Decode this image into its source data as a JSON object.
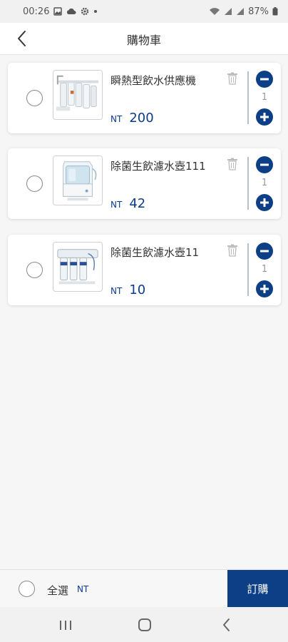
{
  "status_bar": {
    "time": "00:26",
    "left_icons": [
      "gallery-icon",
      "cloud-icon",
      "settings-icon",
      "dot-icon"
    ],
    "battery": "87%",
    "right_icons": [
      "wifi-icon",
      "signal-icon",
      "signal-icon",
      "battery-icon"
    ]
  },
  "header": {
    "title": "購物車",
    "back_icon": "chevron-left-icon"
  },
  "cart": {
    "items": [
      {
        "name": "瞬熱型飲水供應機",
        "currency": "NT",
        "price": "200",
        "quantity": "1"
      },
      {
        "name": "除菌生飲濾水壺111",
        "currency": "NT",
        "price": "42",
        "quantity": "1"
      },
      {
        "name": "除菌生飲濾水壺11",
        "currency": "NT",
        "price": "10",
        "quantity": "1"
      }
    ]
  },
  "footer": {
    "select_all_label": "全選",
    "total_currency": "NT",
    "order_label": "訂購"
  },
  "colors": {
    "accent": "#0d3f86",
    "price": "#0a3c8c",
    "background": "#f6f6f6"
  },
  "nav_bar": {
    "icons": [
      "recent-apps-icon",
      "home-icon",
      "back-icon"
    ]
  }
}
